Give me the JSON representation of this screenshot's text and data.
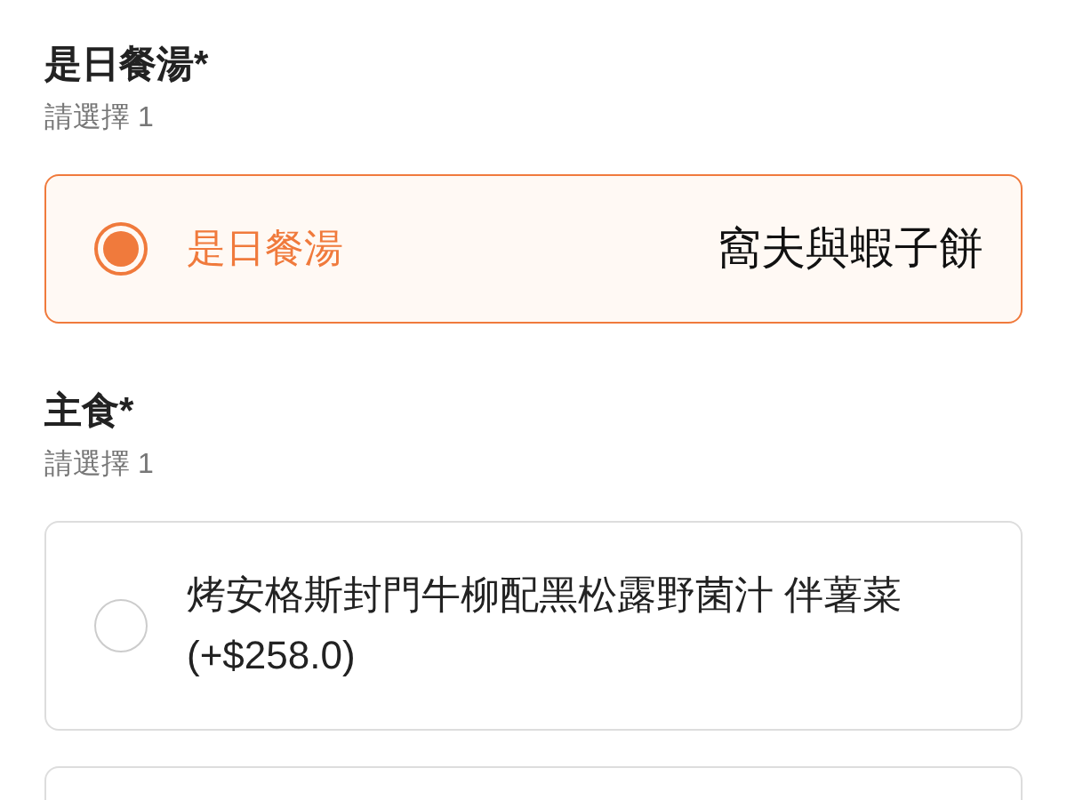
{
  "sections": [
    {
      "title": "是日餐湯*",
      "hint": "請選擇 1",
      "options": [
        {
          "label": "是日餐湯",
          "value": "窩夫與蝦子餅",
          "selected": true
        }
      ]
    },
    {
      "title": "主食*",
      "hint": "請選擇 1",
      "options": [
        {
          "label": "烤安格斯封門牛柳配黑松露野菌汁 伴薯菜",
          "price": "(+$258.0)",
          "selected": false
        },
        {
          "selected": false
        }
      ]
    }
  ]
}
